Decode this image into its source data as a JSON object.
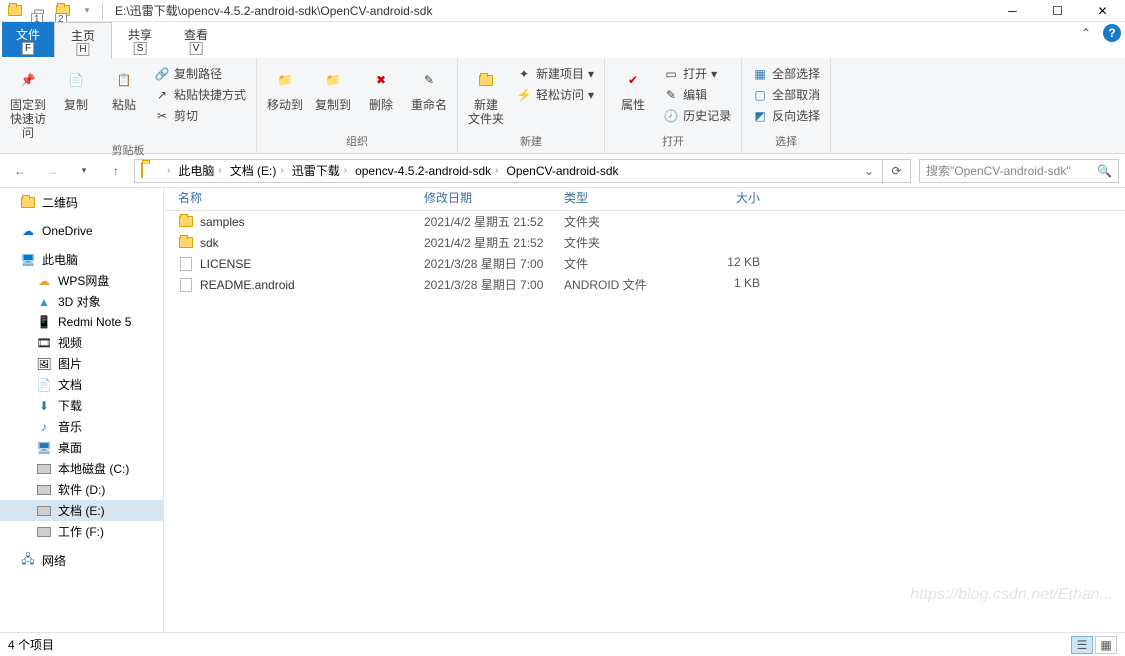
{
  "title": "E:\\迅雷下载\\opencv-4.5.2-android-sdk\\OpenCV-android-sdk",
  "tabs": {
    "file": "文件",
    "home": "主页",
    "share": "共享",
    "view": "查看"
  },
  "hints": {
    "file": "F",
    "home": "H",
    "share": "S",
    "view": "V",
    "q1": "1",
    "q2": "2"
  },
  "ribbon": {
    "pin": "固定到快速访问",
    "copy": "复制",
    "paste": "粘贴",
    "copypath": "复制路径",
    "pasteshortcut": "粘贴快捷方式",
    "cut": "剪切",
    "clip_label": "剪贴板",
    "moveto": "移动到",
    "copyto": "复制到",
    "delete": "删除",
    "rename": "重命名",
    "org_label": "组织",
    "newfolder": "新建\n文件夹",
    "newitem": "新建项目",
    "easyaccess": "轻松访问",
    "new_label": "新建",
    "properties": "属性",
    "open": "打开",
    "edit": "编辑",
    "history": "历史记录",
    "open_label": "打开",
    "selectall": "全部选择",
    "selectnone": "全部取消",
    "invert": "反向选择",
    "select_label": "选择"
  },
  "breadcrumb": [
    "此电脑",
    "文档 (E:)",
    "迅雷下载",
    "opencv-4.5.2-android-sdk",
    "OpenCV-android-sdk"
  ],
  "search_placeholder": "搜索\"OpenCV-android-sdk\"",
  "sidebar": {
    "qrcode": "二维码",
    "onedrive": "OneDrive",
    "thispc": "此电脑",
    "wps": "WPS网盘",
    "objects3d": "3D 对象",
    "redmi": "Redmi Note 5",
    "videos": "视频",
    "pictures": "图片",
    "documents": "文档",
    "downloads": "下载",
    "music": "音乐",
    "desktop": "桌面",
    "diskc": "本地磁盘 (C:)",
    "diskd": "软件 (D:)",
    "diske": "文档 (E:)",
    "diskf": "工作 (F:)",
    "network": "网络"
  },
  "columns": {
    "name": "名称",
    "date": "修改日期",
    "type": "类型",
    "size": "大小"
  },
  "files": [
    {
      "name": "samples",
      "date": "2021/4/2 星期五 21:52",
      "type": "文件夹",
      "size": "",
      "kind": "folder"
    },
    {
      "name": "sdk",
      "date": "2021/4/2 星期五 21:52",
      "type": "文件夹",
      "size": "",
      "kind": "folder"
    },
    {
      "name": "LICENSE",
      "date": "2021/3/28 星期日 7:00",
      "type": "文件",
      "size": "12 KB",
      "kind": "file"
    },
    {
      "name": "README.android",
      "date": "2021/3/28 星期日 7:00",
      "type": "ANDROID 文件",
      "size": "1 KB",
      "kind": "file"
    }
  ],
  "status": "4 个项目"
}
